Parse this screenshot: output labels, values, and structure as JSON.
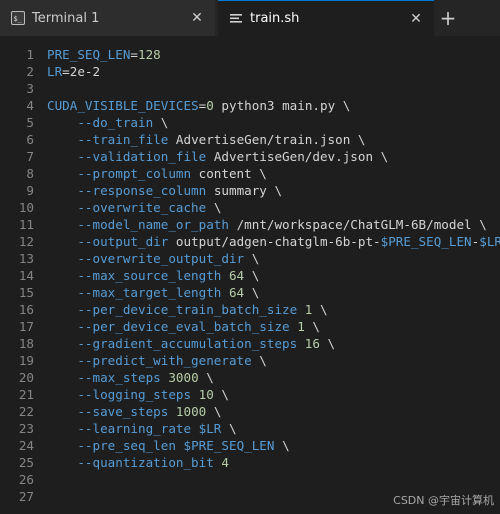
{
  "tabs": [
    {
      "label": "Terminal 1",
      "icon": "terminal-icon",
      "active": false
    },
    {
      "label": "train.sh",
      "icon": "file-text-icon",
      "active": true
    }
  ],
  "new_tab_symbol": "+",
  "close_symbol": "✕",
  "editor": {
    "lines": [
      {
        "n": "1",
        "t": [
          {
            "c": "var",
            "s": "PRE_SEQ_LEN"
          },
          {
            "c": "op",
            "s": "="
          },
          {
            "c": "num",
            "s": "128"
          }
        ]
      },
      {
        "n": "2",
        "t": [
          {
            "c": "var",
            "s": "LR"
          },
          {
            "c": "op",
            "s": "="
          },
          {
            "c": "plain",
            "s": "2e-2"
          }
        ]
      },
      {
        "n": "3",
        "t": []
      },
      {
        "n": "4",
        "t": [
          {
            "c": "var",
            "s": "CUDA_VISIBLE_DEVICES"
          },
          {
            "c": "op",
            "s": "="
          },
          {
            "c": "num",
            "s": "0"
          },
          {
            "c": "plain",
            "s": " python3 main.py \\"
          }
        ]
      },
      {
        "n": "5",
        "t": [
          {
            "c": "flag",
            "s": "    --do_train"
          },
          {
            "c": "cont",
            "s": " \\"
          }
        ]
      },
      {
        "n": "6",
        "t": [
          {
            "c": "flag",
            "s": "    --train_file"
          },
          {
            "c": "arg",
            "s": " AdvertiseGen/train.json \\"
          }
        ]
      },
      {
        "n": "7",
        "t": [
          {
            "c": "flag",
            "s": "    --validation_file"
          },
          {
            "c": "arg",
            "s": " AdvertiseGen/dev.json \\"
          }
        ]
      },
      {
        "n": "8",
        "t": [
          {
            "c": "flag",
            "s": "    --prompt_column"
          },
          {
            "c": "arg",
            "s": " content \\"
          }
        ]
      },
      {
        "n": "9",
        "t": [
          {
            "c": "flag",
            "s": "    --response_column"
          },
          {
            "c": "arg",
            "s": " summary \\"
          }
        ]
      },
      {
        "n": "10",
        "t": [
          {
            "c": "flag",
            "s": "    --overwrite_cache"
          },
          {
            "c": "cont",
            "s": " \\"
          }
        ]
      },
      {
        "n": "11",
        "t": [
          {
            "c": "flag",
            "s": "    --model_name_or_path"
          },
          {
            "c": "arg",
            "s": " /mnt/workspace/ChatGLM-6B/model \\"
          }
        ]
      },
      {
        "n": "12",
        "t": [
          {
            "c": "flag",
            "s": "    --output_dir"
          },
          {
            "c": "arg",
            "s": " output/adgen-chatglm-6b-pt-"
          },
          {
            "c": "var",
            "s": "$PRE_SEQ_LEN"
          },
          {
            "c": "arg",
            "s": "-"
          },
          {
            "c": "var",
            "s": "$LR"
          },
          {
            "c": "arg",
            "s": " \\"
          }
        ]
      },
      {
        "n": "13",
        "t": [
          {
            "c": "flag",
            "s": "    --overwrite_output_dir"
          },
          {
            "c": "cont",
            "s": " \\"
          }
        ]
      },
      {
        "n": "14",
        "t": [
          {
            "c": "flag",
            "s": "    --max_source_length"
          },
          {
            "c": "num",
            "s": " 64"
          },
          {
            "c": "cont",
            "s": " \\"
          }
        ]
      },
      {
        "n": "15",
        "t": [
          {
            "c": "flag",
            "s": "    --max_target_length"
          },
          {
            "c": "num",
            "s": " 64"
          },
          {
            "c": "cont",
            "s": " \\"
          }
        ]
      },
      {
        "n": "16",
        "t": [
          {
            "c": "flag",
            "s": "    --per_device_train_batch_size"
          },
          {
            "c": "num",
            "s": " 1"
          },
          {
            "c": "cont",
            "s": " \\"
          }
        ]
      },
      {
        "n": "17",
        "t": [
          {
            "c": "flag",
            "s": "    --per_device_eval_batch_size"
          },
          {
            "c": "num",
            "s": " 1"
          },
          {
            "c": "cont",
            "s": " \\"
          }
        ]
      },
      {
        "n": "18",
        "t": [
          {
            "c": "flag",
            "s": "    --gradient_accumulation_steps"
          },
          {
            "c": "num",
            "s": " 16"
          },
          {
            "c": "cont",
            "s": " \\"
          }
        ]
      },
      {
        "n": "19",
        "t": [
          {
            "c": "flag",
            "s": "    --predict_with_generate"
          },
          {
            "c": "cont",
            "s": " \\"
          }
        ]
      },
      {
        "n": "20",
        "t": [
          {
            "c": "flag",
            "s": "    --max_steps"
          },
          {
            "c": "num",
            "s": " 3000"
          },
          {
            "c": "cont",
            "s": " \\"
          }
        ]
      },
      {
        "n": "21",
        "t": [
          {
            "c": "flag",
            "s": "    --logging_steps"
          },
          {
            "c": "num",
            "s": " 10"
          },
          {
            "c": "cont",
            "s": " \\"
          }
        ]
      },
      {
        "n": "22",
        "t": [
          {
            "c": "flag",
            "s": "    --save_steps"
          },
          {
            "c": "num",
            "s": " 1000"
          },
          {
            "c": "cont",
            "s": " \\"
          }
        ]
      },
      {
        "n": "23",
        "t": [
          {
            "c": "flag",
            "s": "    --learning_rate"
          },
          {
            "c": "var",
            "s": " $LR"
          },
          {
            "c": "cont",
            "s": " \\"
          }
        ]
      },
      {
        "n": "24",
        "t": [
          {
            "c": "flag",
            "s": "    --pre_seq_len"
          },
          {
            "c": "var",
            "s": " $PRE_SEQ_LEN"
          },
          {
            "c": "cont",
            "s": " \\"
          }
        ]
      },
      {
        "n": "25",
        "t": [
          {
            "c": "flag",
            "s": "    --quantization_bit"
          },
          {
            "c": "num",
            "s": " 4"
          }
        ]
      },
      {
        "n": "26",
        "t": []
      },
      {
        "n": "27",
        "t": []
      }
    ]
  },
  "watermark": "CSDN @宇宙计算机"
}
